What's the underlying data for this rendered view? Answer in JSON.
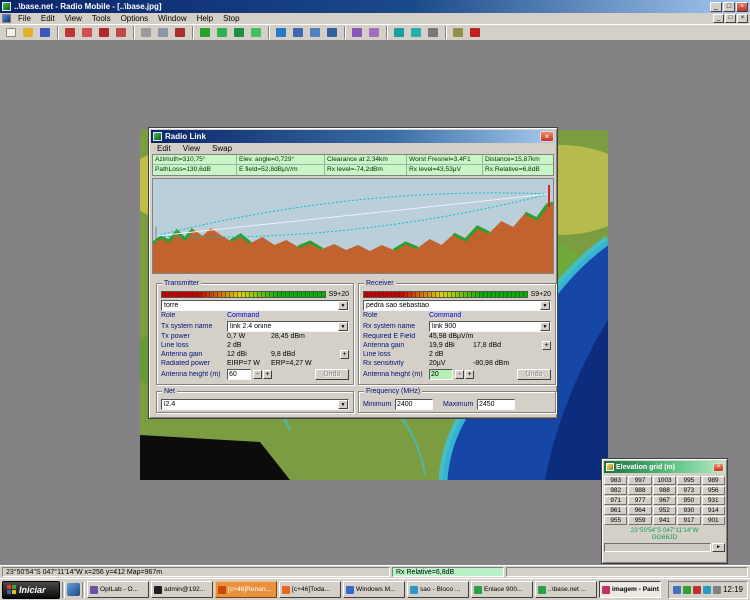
{
  "window": {
    "title": "..\\base.net - Radio Mobile - [..\\base.jpg]",
    "menus": [
      "File",
      "Edit",
      "View",
      "Tools",
      "Options",
      "Window",
      "Help",
      "Stop"
    ]
  },
  "glyphs": {
    "minimize": "_",
    "maximize": "□",
    "close": "×",
    "arrow": "▼",
    "minus": "-",
    "plus": "+",
    "right": "►"
  },
  "toolbar": {
    "icons": [
      {
        "name": "new-networks-icon",
        "style": "background:#f2f2ea;border:1px solid #888"
      },
      {
        "name": "open-networks-icon",
        "style": "background:#e0b030"
      },
      {
        "name": "save-networks-icon",
        "style": "background:#3858c0"
      },
      {
        "name": "map-properties-icon",
        "style": "background:#c03434"
      },
      {
        "name": "picture-properties-icon",
        "style": "background:#d05050"
      },
      {
        "name": "merge-pictures-icon",
        "style": "background:#b02828"
      },
      {
        "name": "elevation-grid-tool-icon",
        "style": "background:#c04848"
      },
      {
        "name": "print-icon",
        "style": "background:#9a9a9a"
      },
      {
        "name": "copy-icon",
        "style": "background:#8898a8"
      },
      {
        "name": "delete-icon",
        "style": "background:#aa3030"
      },
      {
        "name": "network-properties-icon",
        "style": "background:#28a028"
      },
      {
        "name": "unit-properties-icon",
        "style": "background:#30b050"
      },
      {
        "name": "system-properties-icon",
        "style": "background:#209040"
      },
      {
        "name": "radio-link-tool-icon",
        "style": "background:#40c060"
      },
      {
        "name": "single-coverage-icon",
        "style": "background:#2878c8"
      },
      {
        "name": "combined-coverage-icon",
        "style": "background:#4068b0"
      },
      {
        "name": "route-coverage-icon",
        "style": "background:#5080c0"
      },
      {
        "name": "best-site-icon",
        "style": "background:#3060a0"
      },
      {
        "name": "polar-view-icon",
        "style": "background:#8858b8"
      },
      {
        "name": "cartesian-view-icon",
        "style": "background:#a070c0"
      },
      {
        "name": "world-map-icon",
        "style": "background:#18a0a0"
      },
      {
        "name": "internet-icon",
        "style": "background:#20b0b0"
      },
      {
        "name": "gps-icon",
        "style": "background:#787878"
      },
      {
        "name": "aprs-icon",
        "style": "background:#909048"
      },
      {
        "name": "stop-tool-icon",
        "style": "background:#c02020"
      }
    ]
  },
  "dialog": {
    "title": "Radio Link",
    "menus": [
      "Edit",
      "View",
      "Swap"
    ],
    "stats_row1": [
      "Azimuth=310,75°",
      "Elev. angle=0,729°",
      "Clearance at 2,34km",
      "Worst Fresnel=3,4F1",
      "Distance=15,87km"
    ],
    "stats_row2": [
      "PathLoss=130,6dB",
      "E field=52,8dBµV/m",
      "Rx level=-74,2dBm",
      "Rx level=43,53µV",
      "Rx Relative=6,8dB"
    ],
    "transmitter": {
      "group_label": "Transmitter",
      "signal": "S9+20",
      "unit": "torre",
      "role_label": "Role",
      "command_label": "Command",
      "system_label": "Tx system name",
      "system_value": "link 2.4 onine",
      "power_label": "Tx power",
      "power_w": "0,7 W",
      "power_dbm": "28,45 dBm",
      "lineloss_label": "Line loss",
      "lineloss_value": "2 dB",
      "gain_label": "Antenna gain",
      "gain_dbi": "12 dBi",
      "gain_dbd": "9,8 dBd",
      "radiated_label": "Radiated power",
      "eirp": "EIRP=7 W",
      "erp": "ERP=4,27 W",
      "height_label": "Antenna height (m)",
      "height_value": "60",
      "undo_label": "Undo"
    },
    "receiver": {
      "group_label": "Receiver",
      "signal": "S9+20",
      "unit": "pedra sao sebastiao",
      "role_label": "Role",
      "command_label": "Command",
      "system_label": "Rx system name",
      "system_value": "link 900",
      "efield_label": "Required E Field",
      "efield_value": "45,98 dBµV/m",
      "gain_label": "Antenna gain",
      "gain_dbi": "19,9 dBi",
      "gain_dbd": "17,8 dBd",
      "lineloss_label": "Line loss",
      "lineloss_value": "2 dB",
      "sens_label": "Rx sensitivity",
      "sens_uv": "20µV",
      "sens_dbm": "-80,98 dBm",
      "height_label": "Antenna height (m)",
      "height_value": "20",
      "undo_label": "Undo"
    },
    "net": {
      "group_label": "Net",
      "value": "l2.4"
    },
    "frequency": {
      "group_label": "Frequency (MHz)",
      "min_label": "Minimum",
      "min_value": "2400",
      "max_label": "Maximum",
      "max_value": "2450"
    }
  },
  "elevation_grid": {
    "title": "Elevation grid (m)",
    "values": [
      [
        "983",
        "997",
        "1003",
        "995",
        "989"
      ],
      [
        "982",
        "988",
        "988",
        "973",
        "956"
      ],
      [
        "971",
        "977",
        "967",
        "950",
        "931"
      ],
      [
        "961",
        "964",
        "952",
        "930",
        "914"
      ],
      [
        "955",
        "959",
        "941",
        "917",
        "901"
      ]
    ],
    "coords": "23°50'54\"S  047°11'14\"W",
    "locator": "GG66JD"
  },
  "statusbar": {
    "position": "23°50'54\"S  047°11'14\"W   x=256 y=412 Map=967m",
    "highlight": "Rx Relative=6,8dB"
  },
  "taskbar": {
    "start_label": "Iniciar",
    "tasks": [
      {
        "label": "OptLab - O...",
        "style": "background:#7050a0"
      },
      {
        "label": "admin@192...",
        "style": "background:#202020"
      },
      {
        "label": "[c+46]Renan...",
        "style": "background:#c84810"
      },
      {
        "label": "[c+46]Toda...",
        "style": "background:#e86820"
      },
      {
        "label": "Windows M...",
        "style": "background:#3868c8"
      },
      {
        "label": "sao - Bloco ...",
        "style": "background:#2898c8"
      },
      {
        "label": "Enlace 900...",
        "style": "background:#28a048"
      },
      {
        "label": "..\\base.net ...",
        "style": "background:#28a048"
      },
      {
        "label": "imagem - Paint",
        "style": "background:#c03060"
      }
    ],
    "tray_icons": [
      {
        "name": "tray-volume-icon",
        "style": "background:#4070c0"
      },
      {
        "name": "tray-network-icon",
        "style": "background:#30a030"
      },
      {
        "name": "tray-antivirus-icon",
        "style": "background:#c03030"
      },
      {
        "name": "tray-messenger-icon",
        "style": "background:#20a0c0"
      },
      {
        "name": "tray-display-icon",
        "style": "background:#808080"
      }
    ],
    "time": "12:19"
  }
}
